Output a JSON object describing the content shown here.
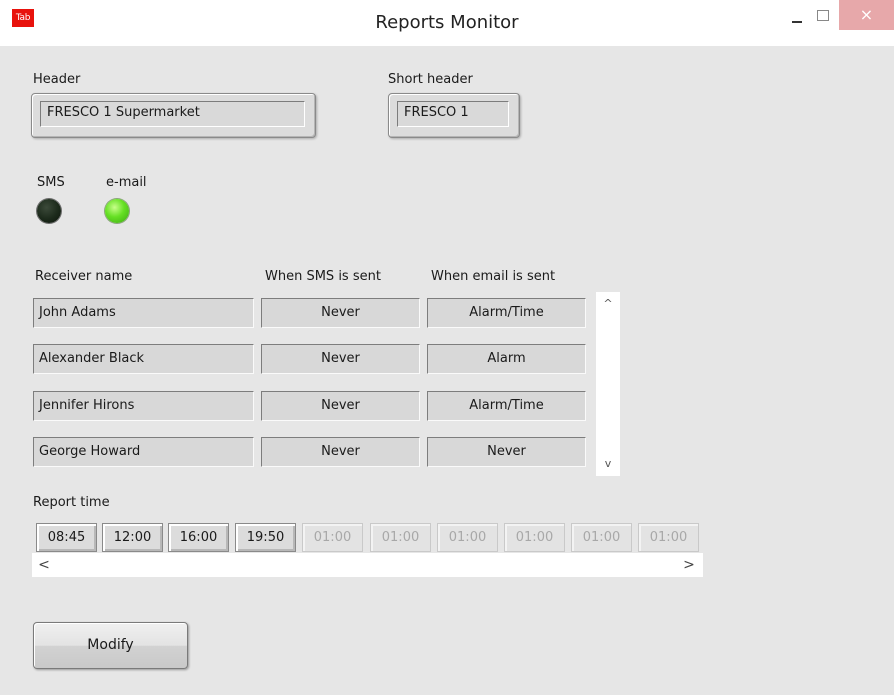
{
  "window": {
    "icon_text": "Tab",
    "title": "Reports Monitor",
    "close_glyph": "×"
  },
  "header": {
    "label": "Header",
    "value": "FRESCO 1 Supermarket"
  },
  "short_header": {
    "label": "Short header",
    "value": "FRESCO 1"
  },
  "indicators": {
    "sms": {
      "label": "SMS",
      "state": "off",
      "color": "#1c2a1b"
    },
    "email": {
      "label": "e-mail",
      "state": "on",
      "color": "#66e024"
    }
  },
  "receivers": {
    "columns": [
      "Receiver name",
      "When SMS is sent",
      "When email is sent"
    ],
    "rows": [
      {
        "name": "John Adams",
        "sms": "Never",
        "email": "Alarm/Time"
      },
      {
        "name": "Alexander Black",
        "sms": "Never",
        "email": "Alarm"
      },
      {
        "name": "Jennifer Hirons",
        "sms": "Never",
        "email": "Alarm/Time"
      },
      {
        "name": "George Howard",
        "sms": "Never",
        "email": "Never"
      }
    ],
    "scroll_up_glyph": "^",
    "scroll_down_glyph": "v"
  },
  "report_time": {
    "label": "Report time",
    "times": [
      {
        "value": "08:45",
        "active": true
      },
      {
        "value": "12:00",
        "active": true
      },
      {
        "value": "16:00",
        "active": true
      },
      {
        "value": "19:50",
        "active": true
      },
      {
        "value": "01:00",
        "active": false
      },
      {
        "value": "01:00",
        "active": false
      },
      {
        "value": "01:00",
        "active": false
      },
      {
        "value": "01:00",
        "active": false
      },
      {
        "value": "01:00",
        "active": false
      },
      {
        "value": "01:00",
        "active": false
      }
    ],
    "scroll_left_glyph": "<",
    "scroll_right_glyph": ">"
  },
  "modify_button": {
    "label": "Modify"
  }
}
